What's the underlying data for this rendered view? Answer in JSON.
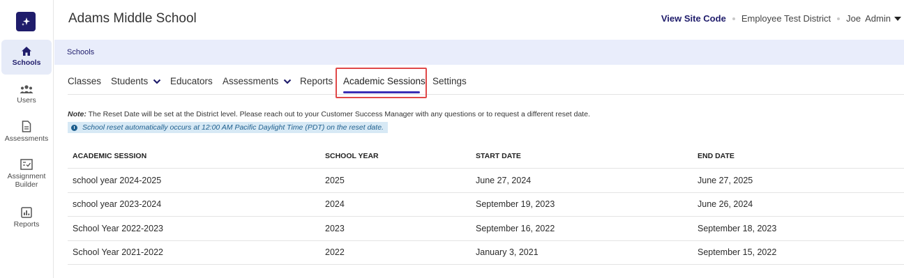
{
  "sidebar": {
    "logo_icon": "sparkle-logo-icon",
    "items": [
      {
        "label": "Schools",
        "icon": "home-icon",
        "active": true
      },
      {
        "label": "Users",
        "icon": "users-icon"
      },
      {
        "label": "Assessments",
        "icon": "document-icon"
      },
      {
        "label": "Assignment Builder",
        "icon": "checklist-icon"
      },
      {
        "label": "Reports",
        "icon": "bar-chart-icon"
      }
    ]
  },
  "header": {
    "title": "Adams Middle School",
    "site_code_link": "View Site Code",
    "district": "Employee Test District",
    "user_first": "Joe",
    "user_last": "Admin"
  },
  "breadcrumb": {
    "label": "Schools"
  },
  "tabs": [
    {
      "label": "Classes"
    },
    {
      "label": "Students",
      "dropdown": true
    },
    {
      "label": "Educators"
    },
    {
      "label": "Assessments",
      "dropdown": true
    },
    {
      "label": "Reports"
    },
    {
      "label": "Academic Sessions",
      "active": true
    },
    {
      "label": "Settings"
    }
  ],
  "note": {
    "prefix": "Note:",
    "text": " The Reset Date will be set at the District level. Please reach out to your Customer Success Manager with any questions or to request a different reset date.",
    "info": "School reset automatically occurs at 12:00 AM Pacific Daylight Time (PDT) on the reset date."
  },
  "table": {
    "headers": [
      "ACADEMIC SESSION",
      "SCHOOL YEAR",
      "START DATE",
      "END DATE"
    ],
    "rows": [
      [
        "school year 2024-2025",
        "2025",
        "June 27, 2024",
        "June 27, 2025"
      ],
      [
        "school year 2023-2024",
        "2024",
        "September 19, 2023",
        "June 26, 2024"
      ],
      [
        "School Year 2022-2023",
        "2023",
        "September 16, 2022",
        "September 18, 2023"
      ],
      [
        "School Year 2021-2022",
        "2022",
        "January 3, 2021",
        "September 15, 2022"
      ]
    ]
  },
  "colors": {
    "brand": "#1f1c6b",
    "accent": "#3b2fb5",
    "highlight": "#e04848",
    "band": "#e9edfb"
  }
}
